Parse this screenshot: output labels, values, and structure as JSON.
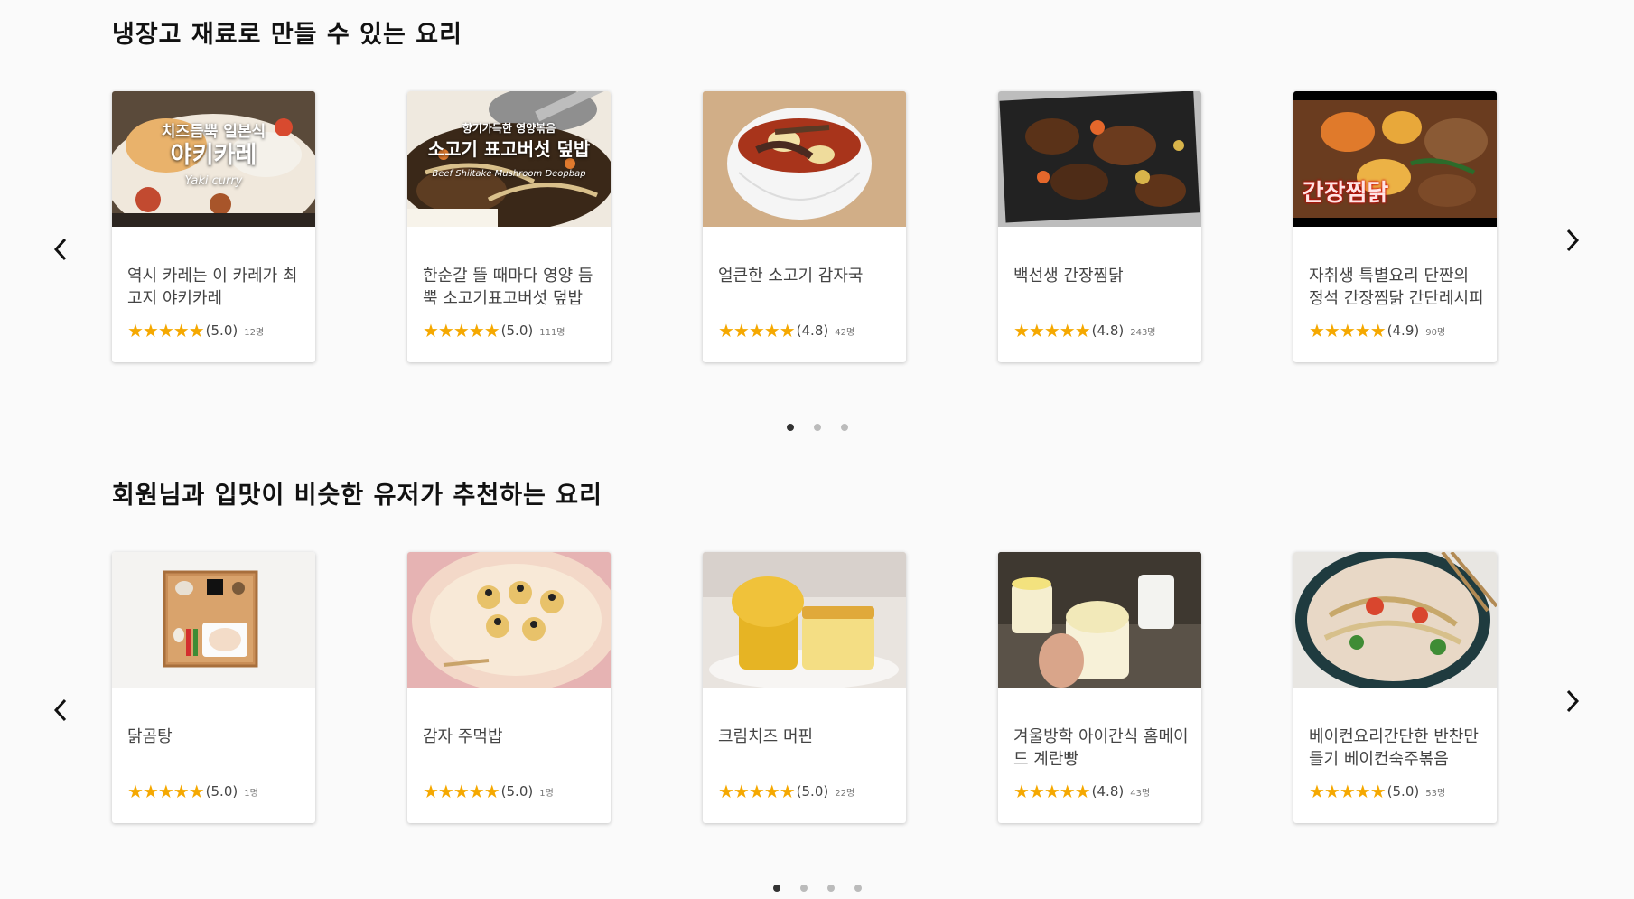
{
  "sections": [
    {
      "title": "냉장고 재료로 만들 수 있는 요리",
      "cards": [
        {
          "title": "역시 카레는 이 카레가 최고지 야키카레",
          "stars": "★★★★★",
          "score": "(5.0)",
          "count": "12명",
          "overlay_top": "치즈듬뿍 일본식",
          "overlay_main": "야키카레",
          "overlay_sub": "Yaki curry"
        },
        {
          "title": "한순갈 뜰 때마다 영양 듬뿍 소고기표고버섯 덮밥",
          "stars": "★★★★★",
          "score": "(5.0)",
          "count": "111명",
          "overlay_top": "향기가득한 영양볶음",
          "overlay_main": "소고기 표고버섯 덮밥",
          "overlay_sub": "Beef Shiitake Mushroom Deopbap"
        },
        {
          "title": "얼큰한 소고기 감자국",
          "stars": "★★★★★",
          "score": "(4.8)",
          "count": "42명"
        },
        {
          "title": "백선생 간장찜닭",
          "stars": "★★★★★",
          "score": "(4.8)",
          "count": "243명"
        },
        {
          "title": "자취생 특별요리 단짠의 정석 간장찜닭 간단레시피",
          "stars": "★★★★★",
          "score": "(4.9)",
          "count": "90명",
          "overlay_main": "간장찜닭"
        }
      ],
      "dots": 3,
      "active_dot": 0
    },
    {
      "title": "회원님과 입맛이 비슷한 유저가 추천하는 요리",
      "cards": [
        {
          "title": "닭곰탕",
          "stars": "★★★★★",
          "score": "(5.0)",
          "count": "1명"
        },
        {
          "title": "감자 주먹밥",
          "stars": "★★★★★",
          "score": "(5.0)",
          "count": "1명"
        },
        {
          "title": "크림치즈 머핀",
          "stars": "★★★★★",
          "score": "(5.0)",
          "count": "22명"
        },
        {
          "title": "겨울방학 아이간식 홈메이드 계란빵",
          "stars": "★★★★★",
          "score": "(4.8)",
          "count": "43명"
        },
        {
          "title": "베이컨요리간단한 반찬만들기 베이컨숙주볶음",
          "stars": "★★★★★",
          "score": "(5.0)",
          "count": "53명"
        }
      ],
      "dots": 4,
      "active_dot": 0
    }
  ],
  "icons": {
    "prev": "chevron-left-icon",
    "next": "chevron-right-icon"
  },
  "colors": {
    "star": "#f5a800",
    "background": "#fafafa",
    "dot_active": "#333333",
    "dot_inactive": "#bbbbbb"
  }
}
